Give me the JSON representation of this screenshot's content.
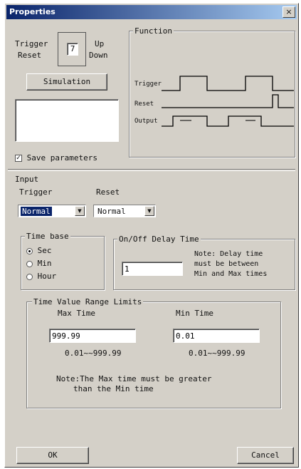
{
  "window": {
    "title": "Properties",
    "close_glyph": "×"
  },
  "mode": {
    "trigger_label": "Trigger",
    "reset_label": "Reset",
    "up_label": "Up",
    "down_label": "Down",
    "value": "7"
  },
  "simulation_button": "Simulation",
  "function_group": {
    "title": "Function",
    "signals": [
      "Trigger",
      "Reset",
      "Output"
    ]
  },
  "save_parameters": {
    "label": "Save parameters",
    "checked": true
  },
  "input": {
    "group_title": "Input",
    "trigger_label": "Trigger",
    "trigger_value": "Normal",
    "reset_label": "Reset",
    "reset_value": "Normal"
  },
  "time_base": {
    "title": "Time base",
    "options": [
      "Sec",
      "Min",
      "Hour"
    ],
    "selected": "Sec"
  },
  "onoff": {
    "title": "On/Off Delay Time",
    "value": "1",
    "note": [
      "Note: Delay time",
      "must be between",
      "Min and Max times"
    ]
  },
  "limits": {
    "title": "Time Value Range Limits",
    "max_label": "Max Time",
    "max_value": "999.99",
    "max_range": "0.01~~999.99",
    "min_label": "Min Time",
    "min_value": "0.01",
    "min_range": "0.01~~999.99",
    "note_line1": "Note:The Max time must be greater",
    "note_line2": "than the Min time"
  },
  "buttons": {
    "ok": "OK",
    "cancel": "Cancel"
  }
}
